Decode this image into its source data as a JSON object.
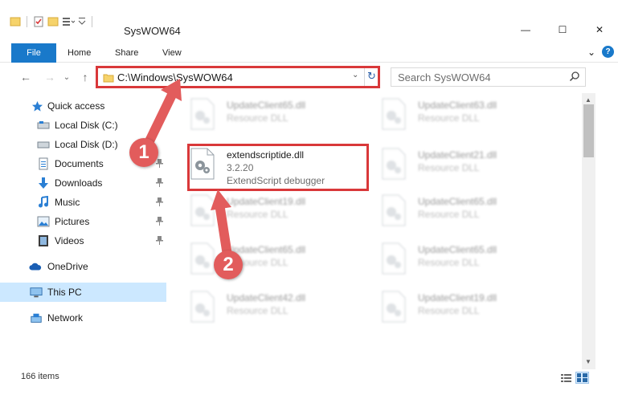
{
  "window": {
    "title": "SysWOW64",
    "minimize_glyph": "—",
    "maximize_glyph": "☐",
    "close_glyph": "✕"
  },
  "ribbon": {
    "tabs": [
      "File",
      "Home",
      "Share",
      "View"
    ],
    "help": "?",
    "expand_glyph": "⌄"
  },
  "navigation": {
    "back": "←",
    "forward": "→",
    "recent": "⌄",
    "up": "↑",
    "address_path": "C:\\Windows\\SysWOW64",
    "dropdown": "⌄",
    "refresh": "↻",
    "search_placeholder": "Search SysWOW64"
  },
  "sidebar": {
    "items": [
      {
        "label": "Quick access",
        "icon": "star-icon"
      },
      {
        "label": "Local Disk (C:)",
        "icon": "drive-icon"
      },
      {
        "label": "Local Disk (D:)",
        "icon": "drive-icon"
      },
      {
        "label": "Documents",
        "icon": "documents-icon"
      },
      {
        "label": "Downloads",
        "icon": "download-icon"
      },
      {
        "label": "Music",
        "icon": "music-icon"
      },
      {
        "label": "Pictures",
        "icon": "pictures-icon"
      },
      {
        "label": "Videos",
        "icon": "videos-icon"
      },
      {
        "label": "OneDrive",
        "icon": "cloud-icon"
      },
      {
        "label": "This PC",
        "icon": "computer-icon"
      },
      {
        "label": "Network",
        "icon": "network-icon"
      }
    ]
  },
  "files": [
    {
      "name": "UpdateClient65.dll",
      "desc": "Resource DLL",
      "desc2": ""
    },
    {
      "name": "UpdateClient63.dll",
      "desc": "Resource DLL",
      "desc2": ""
    },
    {
      "name": "extendscriptide.dll",
      "desc": "3.2.20",
      "desc2": "ExtendScript debugger"
    },
    {
      "name": "UpdateClient21.dll",
      "desc": "Resource DLL",
      "desc2": ""
    },
    {
      "name": "UpdateClient19.dll",
      "desc": "Resource DLL",
      "desc2": ""
    },
    {
      "name": "UpdateClient65.dll",
      "desc": "Resource DLL",
      "desc2": ""
    },
    {
      "name": "UpdateClient65.dll",
      "desc": "Resource DLL",
      "desc2": ""
    },
    {
      "name": "UpdateClient65.dll",
      "desc": "Resource DLL",
      "desc2": ""
    },
    {
      "name": "UpdateClient42.dll",
      "desc": "Resource DLL",
      "desc2": ""
    },
    {
      "name": "UpdateClient19.dll",
      "desc": "Resource DLL",
      "desc2": ""
    }
  ],
  "status": {
    "item_count": "166 items"
  },
  "annotations": {
    "step1": "1",
    "step2": "2",
    "color": "#e25c5c"
  },
  "colors": {
    "accent": "#1979ca",
    "highlight_border": "#d9383a",
    "selected_bg": "#cce8ff"
  }
}
